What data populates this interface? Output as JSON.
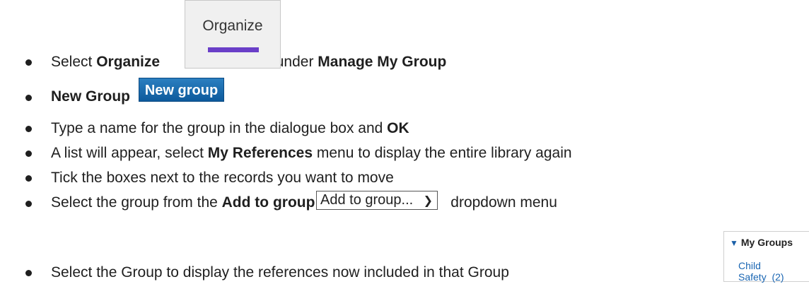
{
  "steps": [
    {
      "pre": "Select ",
      "bold": "Organize",
      "post": ", under ",
      "bold2": "Manage My Group"
    },
    {
      "bold": "New Group"
    },
    {
      "pre": "Type a name for the group in the dialogue box and ",
      "bold": "OK"
    },
    {
      "pre": "A list will appear, select ",
      "bold": "My References",
      "post": " menu to display the entire library again"
    },
    {
      "pre": "Tick the boxes next to the records you want to move"
    },
    {
      "pre": "Select the group from the ",
      "bold": "Add to group",
      "post": " dropdown menu"
    },
    {
      "pre": "Select the Group to display the references now included in that Group"
    }
  ],
  "organize_button": {
    "label": "Organize",
    "bar_color": "#6a3fc8"
  },
  "new_group_button": {
    "label": "New group"
  },
  "add_to_group_select": {
    "value": "Add to group...",
    "icon": "chevron-down-icon"
  },
  "my_groups_panel": {
    "header": "My Groups",
    "item": "Child Safety",
    "count": "(2)",
    "icon": "triangle-down-icon"
  }
}
